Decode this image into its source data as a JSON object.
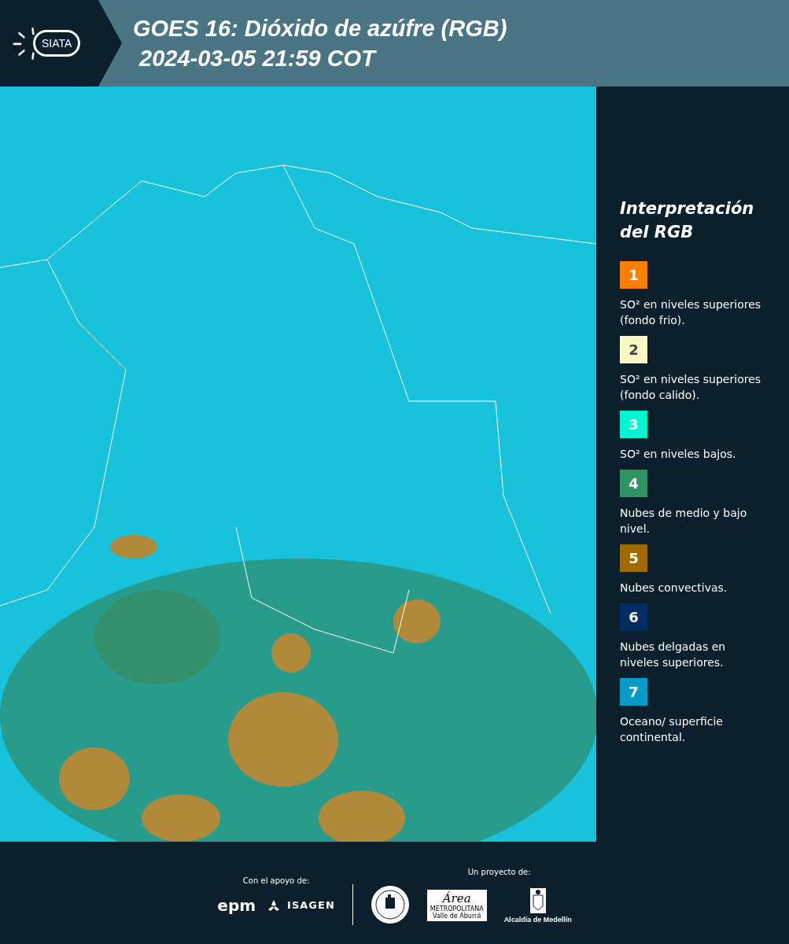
{
  "header": {
    "logo_text": "SIATA",
    "title": "GOES 16: Dióxido de azúfre (RGB)",
    "timestamp": "2024-03-05 21:59 COT"
  },
  "legend": {
    "title": "Interpretación del RGB",
    "items": [
      {
        "number": "1",
        "color": "#ff7f00",
        "text": "SO² en niveles superiores (fondo frio)."
      },
      {
        "number": "2",
        "color": "#fff8c0",
        "text": "SO² en niveles superiores (fondo calido)."
      },
      {
        "number": "3",
        "color": "#00f5d0",
        "text": "SO² en niveles bajos."
      },
      {
        "number": "4",
        "color": "#2e9464",
        "text": "Nubes de medio y bajo nivel."
      },
      {
        "number": "5",
        "color": "#a06a00",
        "text": "Nubes convectivas."
      },
      {
        "number": "6",
        "color": "#002e63",
        "text": "Nubes delgadas en niveles superiores."
      },
      {
        "number": "7",
        "color": "#0a9ac8",
        "text": "Oceano/ superficie continental."
      }
    ]
  },
  "footer": {
    "support_label": "Con el apoyo de:",
    "support_logos": [
      "epm",
      "ISAGEN"
    ],
    "project_label": "Un proyecto de:",
    "area_logo": {
      "mark": "Área",
      "line1": "METROPOLITANA",
      "line2": "Valle de Aburrá"
    },
    "city_logo": "Alcaldía de Medellín"
  }
}
